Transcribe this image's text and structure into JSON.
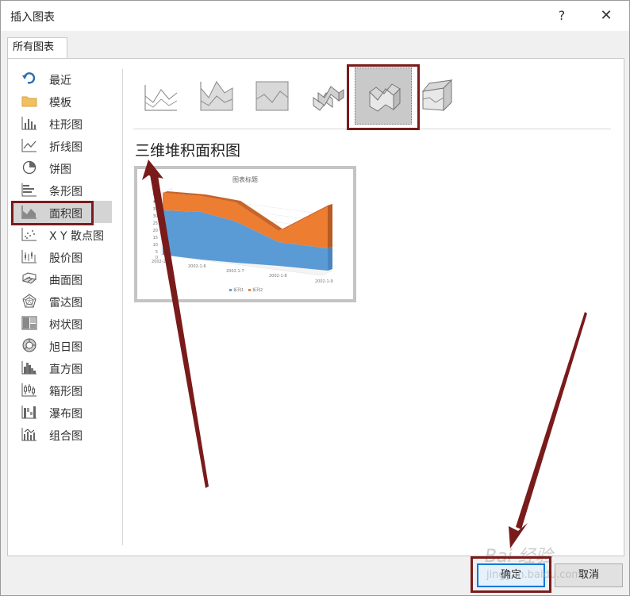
{
  "dialog": {
    "title": "插入图表",
    "help": "?",
    "close": "✕"
  },
  "tabs": [
    {
      "label": "所有图表"
    }
  ],
  "sidebar": {
    "items": [
      {
        "label": "最近",
        "icon": "recent-icon"
      },
      {
        "label": "模板",
        "icon": "folder-icon"
      },
      {
        "label": "柱形图",
        "icon": "column-chart-icon"
      },
      {
        "label": "折线图",
        "icon": "line-chart-icon"
      },
      {
        "label": "饼图",
        "icon": "pie-chart-icon"
      },
      {
        "label": "条形图",
        "icon": "bar-chart-icon"
      },
      {
        "label": "面积图",
        "icon": "area-chart-icon",
        "selected": true
      },
      {
        "label": "X Y 散点图",
        "icon": "scatter-chart-icon"
      },
      {
        "label": "股价图",
        "icon": "stock-chart-icon"
      },
      {
        "label": "曲面图",
        "icon": "surface-chart-icon"
      },
      {
        "label": "雷达图",
        "icon": "radar-chart-icon"
      },
      {
        "label": "树状图",
        "icon": "treemap-chart-icon"
      },
      {
        "label": "旭日图",
        "icon": "sunburst-chart-icon"
      },
      {
        "label": "直方图",
        "icon": "histogram-chart-icon"
      },
      {
        "label": "箱形图",
        "icon": "box-whisker-chart-icon"
      },
      {
        "label": "瀑布图",
        "icon": "waterfall-chart-icon"
      },
      {
        "label": "组合图",
        "icon": "combo-chart-icon"
      }
    ]
  },
  "subtypes": [
    {
      "icon": "area-icon"
    },
    {
      "icon": "stacked-area-icon"
    },
    {
      "icon": "100-stacked-area-icon"
    },
    {
      "icon": "3d-area-icon"
    },
    {
      "icon": "3d-stacked-area-icon",
      "selected": true
    },
    {
      "icon": "3d-100-stacked-area-icon"
    }
  ],
  "selected_chart": {
    "name": "三维堆积面积图"
  },
  "preview": {
    "title": "图表标题",
    "y_ticks": [
      "45",
      "40",
      "35",
      "30",
      "25",
      "20",
      "15",
      "10",
      "5",
      "0"
    ],
    "x_ticks": [
      "2002-1-5",
      "2002-1-6",
      "2002-1-7",
      "2002-1-8",
      "2002-1-9"
    ],
    "legend": [
      "系列1",
      "系列2"
    ],
    "series_colors": [
      "#5b9bd5",
      "#ed7d31"
    ]
  },
  "buttons": {
    "ok": "确定",
    "cancel": "取消"
  },
  "annotation_color": "#7a1b1b",
  "watermark": {
    "text": "Bai 经验",
    "sub": "jingyan.baidu.com"
  }
}
